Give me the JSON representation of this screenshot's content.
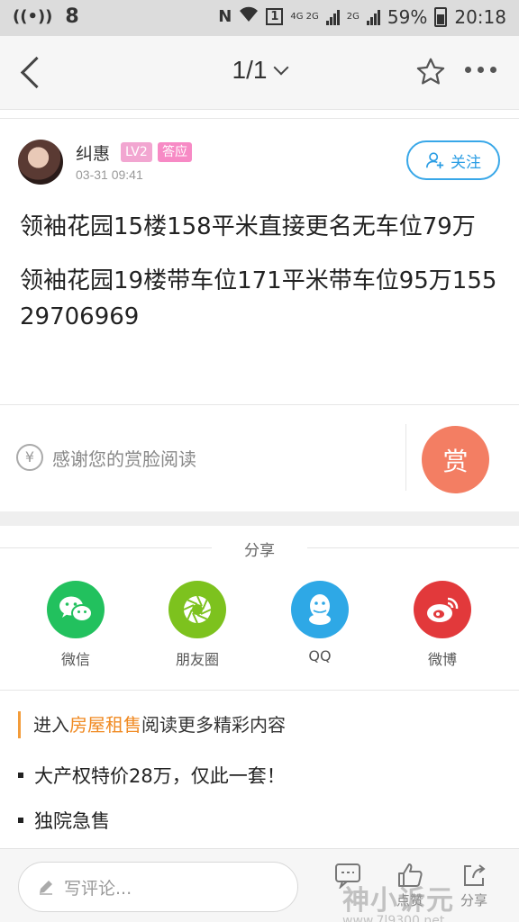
{
  "status_bar": {
    "left_number": "8",
    "network": "4G 2G",
    "network2": "2G",
    "battery": "59%",
    "time": "20:18"
  },
  "nav": {
    "page_indicator": "1/1",
    "icons": [
      "back-icon",
      "star-icon",
      "more-icon"
    ]
  },
  "post": {
    "username": "纠惠",
    "level_badge": "LV2",
    "role_badge": "答应",
    "timestamp": "03-31 09:41",
    "follow_label": "关注",
    "paragraphs": [
      "领袖花园15楼158平米直接更名无车位79万",
      "领袖花园19楼带车位171平米带车位95万15529706969"
    ]
  },
  "reward": {
    "yen_symbol": "¥",
    "thanks_text": "感谢您的赏脸阅读",
    "reward_button": "赏",
    "reward_color": "#f37e63"
  },
  "share": {
    "title": "分享",
    "items": [
      {
        "label": "微信",
        "icon": "wechat-icon",
        "color": "#22c15e"
      },
      {
        "label": "朋友圈",
        "icon": "moments-icon",
        "color": "#7dc21e"
      },
      {
        "label": "QQ",
        "icon": "qq-icon",
        "color": "#2ea8e6"
      },
      {
        "label": "微博",
        "icon": "weibo-icon",
        "color": "#e2393b"
      }
    ]
  },
  "related": {
    "prefix": "进入",
    "section": "房屋租售",
    "suffix": "阅读更多精彩内容",
    "items": [
      "大产权特价28万，仅此一套！",
      "独院急售"
    ]
  },
  "bottom_bar": {
    "comment_placeholder": "写评论...",
    "like_label": "点赞",
    "share_label": "分享"
  },
  "watermark": {
    "text": "神小诉元",
    "url": "www.7l9300.net"
  }
}
